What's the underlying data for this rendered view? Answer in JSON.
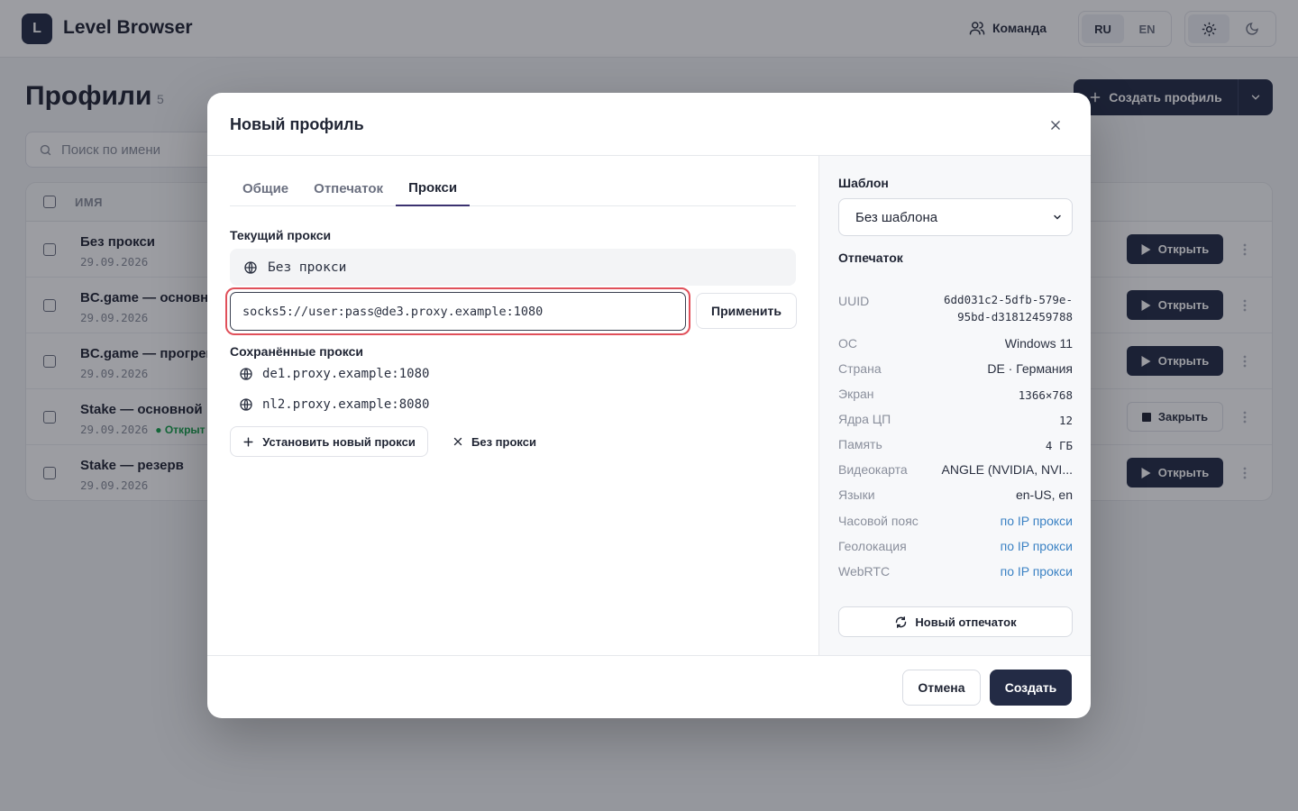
{
  "app": {
    "logo_letter": "L",
    "title": "Level Browser"
  },
  "header": {
    "team_label": "Команда",
    "langs": [
      "RU",
      "EN"
    ],
    "active_lang": "RU"
  },
  "page": {
    "title": "Профили",
    "count": "5",
    "create_label": "Создать профиль",
    "search_placeholder": "Поиск по имени",
    "column_name": "ИМЯ"
  },
  "profiles": [
    {
      "name": "Без прокси",
      "date": "29.09.2026",
      "status": "",
      "action": "Открыть"
    },
    {
      "name": "BC.game — основной",
      "date": "29.09.2026",
      "status": "",
      "action": "Открыть"
    },
    {
      "name": "BC.game — прогрев",
      "date": "29.09.2026",
      "status": "",
      "action": "Открыть"
    },
    {
      "name": "Stake — основной",
      "date": "29.09.2026",
      "status": "● Открыт",
      "action": "Закрыть"
    },
    {
      "name": "Stake — резерв",
      "date": "29.09.2026",
      "status": "",
      "action": "Открыть"
    }
  ],
  "modal": {
    "title": "Новый профиль",
    "tabs": [
      "Общие",
      "Отпечаток",
      "Прокси"
    ],
    "active_tab": "Прокси",
    "current_proxy_label": "Текущий прокси",
    "current_proxy_value": "Без прокси",
    "proxy_input_value": "socks5://user:pass@de3.proxy.example:1080",
    "apply_label": "Применить",
    "saved_label": "Сохранённые прокси",
    "saved_proxies": [
      "de1.proxy.example:1080",
      "nl2.proxy.example:8080"
    ],
    "install_label": "Установить новый прокси",
    "no_proxy_label": "Без прокси",
    "template_label": "Шаблон",
    "template_value": "Без шаблона",
    "fingerprint_label": "Отпечаток",
    "fingerprint": {
      "uuid_key": "UUID",
      "uuid_line1": "6dd031c2-5dfb-579e-",
      "uuid_line2": "95bd-d31812459788",
      "os_key": "ОС",
      "os": "Windows 11",
      "country_key": "Страна",
      "country": "DE · Германия",
      "screen_key": "Экран",
      "screen": "1366×768",
      "cores_key": "Ядра ЦП",
      "cores": "12",
      "memory_key": "Память",
      "memory": "4 ГБ",
      "gpu_key": "Видеокарта",
      "gpu": "ANGLE (NVIDIA, NVI...",
      "langs_key": "Языки",
      "langs": "en-US, en",
      "tz_key": "Часовой пояс",
      "tz": "по IP прокси",
      "geo_key": "Геолокация",
      "geo": "по IP прокси",
      "webrtc_key": "WebRTC",
      "webrtc": "по IP прокси"
    },
    "new_fp_label": "Новый отпечаток",
    "cancel_label": "Отмена",
    "submit_label": "Создать"
  },
  "colors": {
    "primary": "#232b45",
    "alert": "#e0505a",
    "link": "#3b82c4",
    "online": "#16a34a"
  }
}
